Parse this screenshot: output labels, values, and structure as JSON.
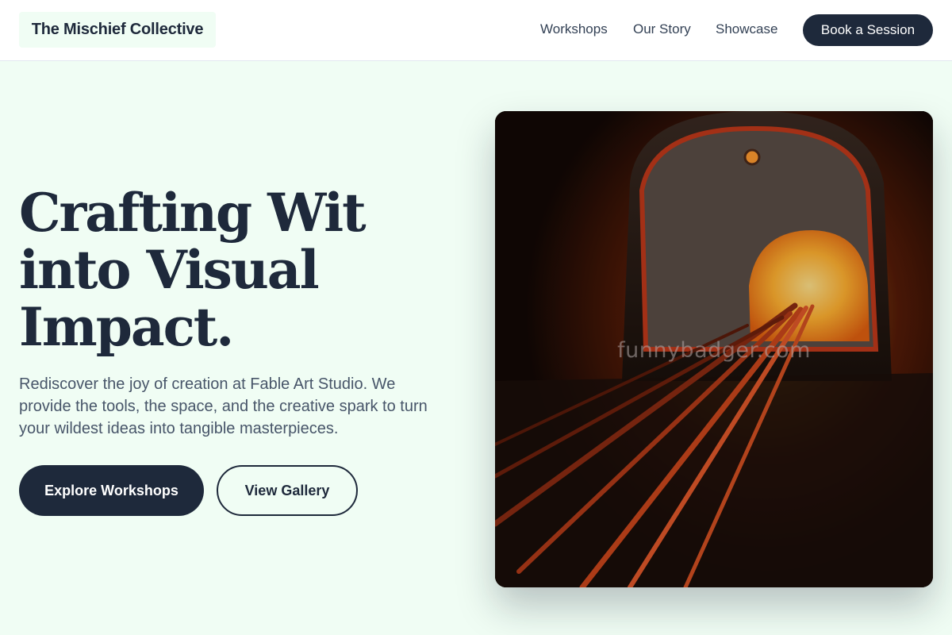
{
  "header": {
    "brand": "The Mischief Collective",
    "nav": [
      {
        "label": "Workshops"
      },
      {
        "label": "Our Story"
      },
      {
        "label": "Showcase"
      }
    ],
    "cta_label": "Book a Session"
  },
  "hero": {
    "title_lines": [
      "Crafting Wit",
      "into Visual",
      "Impact."
    ],
    "description": "Rediscover the joy of creation at Fable Art Studio. We provide the tools, the space, and the creative spark to turn your wildest ideas into tangible masterpieces.",
    "primary_button": "Explore Workshops",
    "secondary_button": "View Gallery",
    "image": {
      "subject": "glass furnace with glowing rods",
      "watermark": "funnybadger.com"
    }
  },
  "colors": {
    "page_background": "#f0fdf4",
    "primary_dark": "#1e293b",
    "body_text": "#475569",
    "furnace_glow": "#ff9a1f"
  }
}
